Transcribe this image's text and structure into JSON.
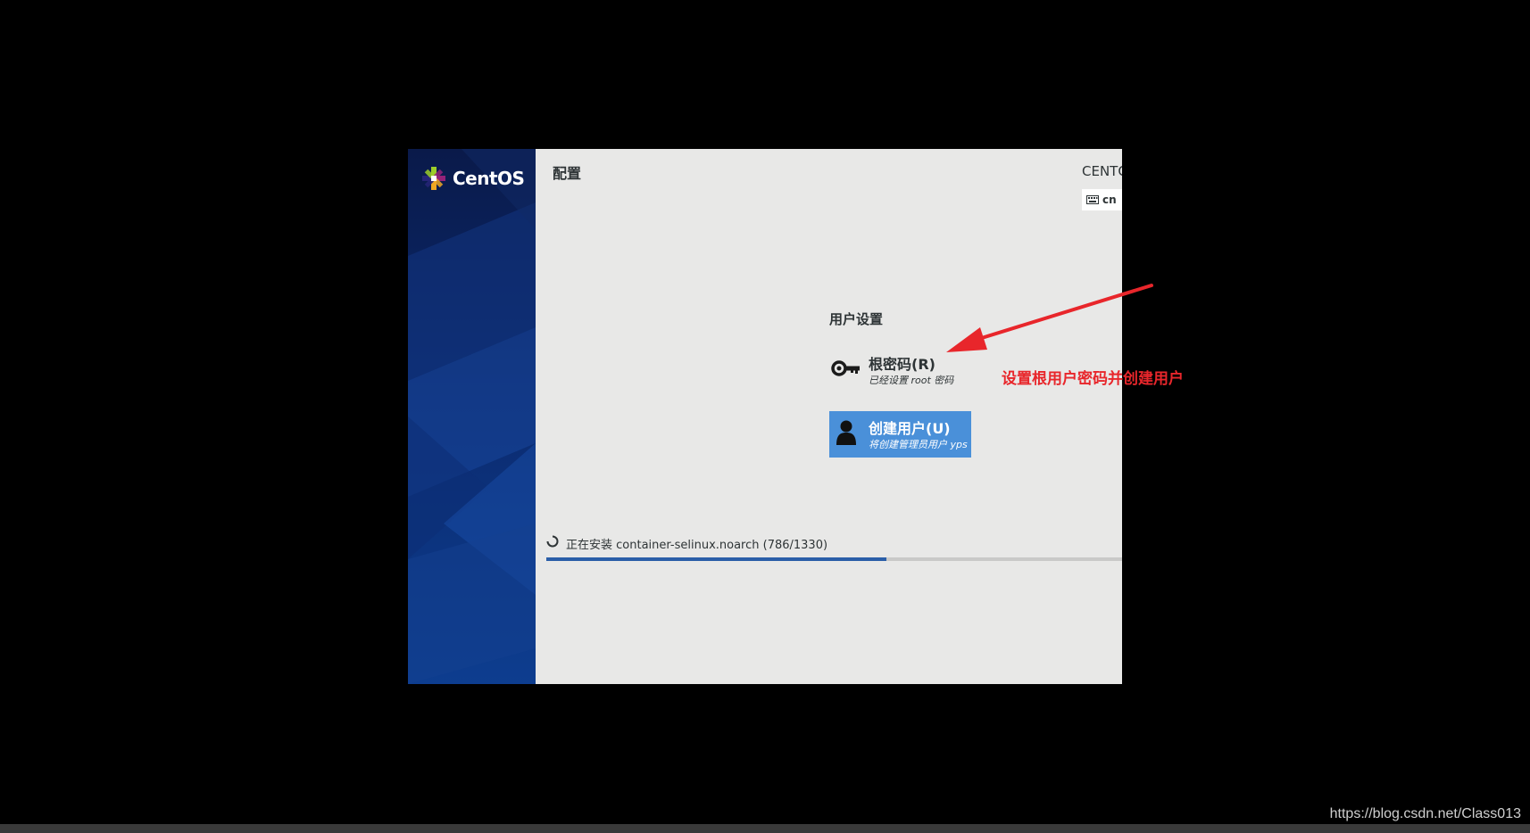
{
  "window": {
    "brand": "CentOS",
    "page_title": "配置",
    "product_name": "CENTOS",
    "keyboard_layout": "cn"
  },
  "user_settings": {
    "heading": "用户设置",
    "spokes": [
      {
        "title": "根密码(R)",
        "status": "已经设置 root 密码",
        "icon": "key-icon",
        "selected": false
      },
      {
        "title": "创建用户(U)",
        "status": "将创建管理员用户 yps",
        "icon": "user-icon",
        "selected": true
      }
    ]
  },
  "progress": {
    "text": "正在安装 container-selinux.noarch (786/1330)",
    "fraction": 0.59
  },
  "annotation": {
    "text": "设置根用户密码并创建用户",
    "color": "#e8262b"
  },
  "watermark": "https://blog.csdn.net/Class013",
  "colors": {
    "selected_spoke": "#4a90d9",
    "progress_fill": "#2a5ea8",
    "sidebar": "#0b2a6e"
  }
}
